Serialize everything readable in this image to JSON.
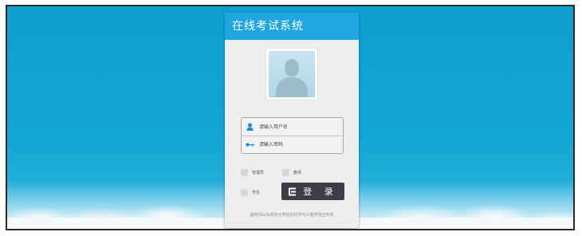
{
  "app": {
    "title": "在线考试系统"
  },
  "login_form": {
    "username_placeholder": "请输入用户名",
    "password_placeholder": "请输入密码"
  },
  "roles": [
    {
      "label": "管理员",
      "checked": false
    },
    {
      "label": "教师",
      "checked": false
    },
    {
      "label": "学生",
      "checked": false
    }
  ],
  "login_button": {
    "label": "登 录",
    "icon": "login-icon"
  },
  "footer": {
    "copyright": "版权归山东师范大学信息科学与工程学院王所有"
  },
  "colors": {
    "header": "#1fa6e0",
    "sky": "#12a6d4",
    "button": "#3b3f45",
    "icon": "#1f8fd6"
  }
}
